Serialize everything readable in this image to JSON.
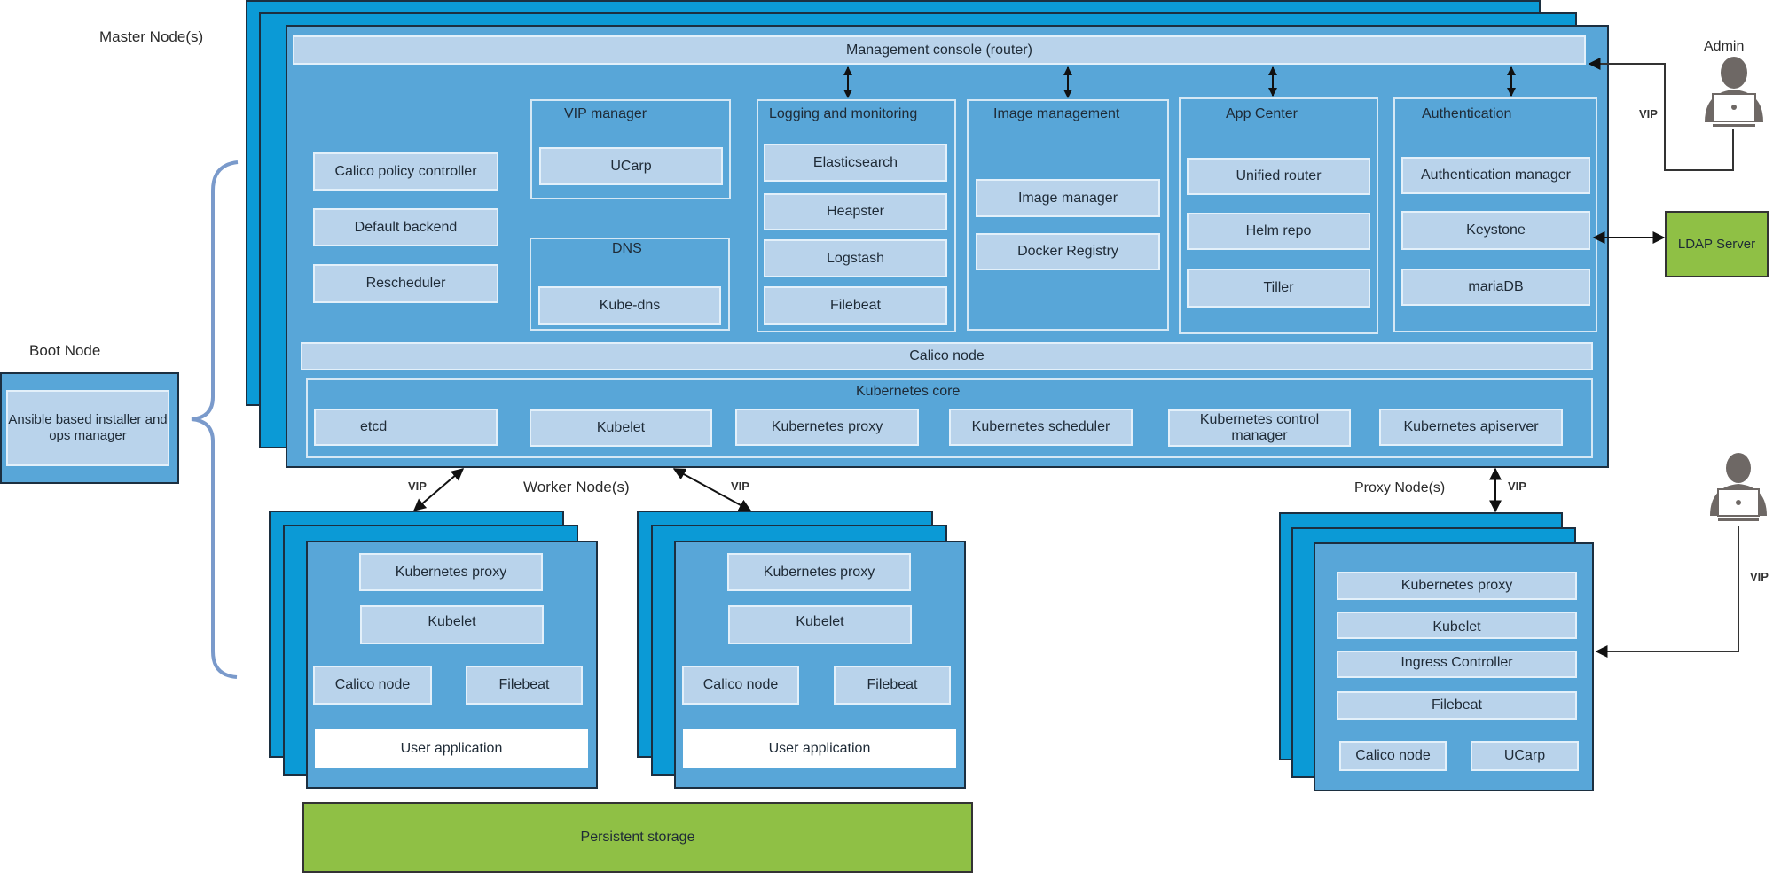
{
  "labels": {
    "master_nodes": "Master Node(s)",
    "boot_node": "Boot Node",
    "worker_nodes": "Worker Node(s)",
    "proxy_nodes": "Proxy Node(s)",
    "admin": "Admin",
    "vip": "VIP"
  },
  "boot": {
    "component": "Ansible based installer and ops manager"
  },
  "master": {
    "management_console": "Management console (router)",
    "standalone": [
      "Calico policy controller",
      "Default backend",
      "Rescheduler"
    ],
    "vip_manager": {
      "title": "VIP manager",
      "items": [
        "UCarp"
      ]
    },
    "dns": {
      "title": "DNS",
      "items": [
        "Kube-dns"
      ]
    },
    "logging": {
      "title": "Logging and monitoring",
      "items": [
        "Elasticsearch",
        "Heapster",
        "Logstash",
        "Filebeat"
      ]
    },
    "image": {
      "title": "Image management",
      "items": [
        "Image manager",
        "Docker Registry"
      ]
    },
    "app_center": {
      "title": "App Center",
      "items": [
        "Unified router",
        "Helm repo",
        "Tiller"
      ]
    },
    "auth": {
      "title": "Authentication",
      "items": [
        "Authentication manager",
        "Keystone",
        "mariaDB"
      ]
    },
    "calico_node": "Calico node",
    "k8s_core": {
      "title": "Kubernetes core",
      "items": [
        "etcd",
        "Kubelet",
        "Kubernetes proxy",
        "Kubernetes scheduler",
        "Kubernetes control manager",
        "Kubernetes apiserver"
      ]
    }
  },
  "ldap": "LDAP Server",
  "workers": [
    {
      "items": [
        "Kubernetes proxy",
        "Kubelet",
        "Calico node",
        "Filebeat",
        "User application"
      ]
    },
    {
      "items": [
        "Kubernetes proxy",
        "Kubelet",
        "Calico node",
        "Filebeat",
        "User application"
      ]
    }
  ],
  "proxy": {
    "items": [
      "Kubernetes proxy",
      "Kubelet",
      "Ingress Controller",
      "Filebeat",
      "Calico node",
      "UCarp"
    ]
  },
  "storage": "Persistent storage",
  "colors": {
    "node_back": "#0b9ad6",
    "node_front": "#58a6d8",
    "component": "#b9d3eb",
    "green": "#8fc045",
    "bracket": "#7a9acb"
  }
}
